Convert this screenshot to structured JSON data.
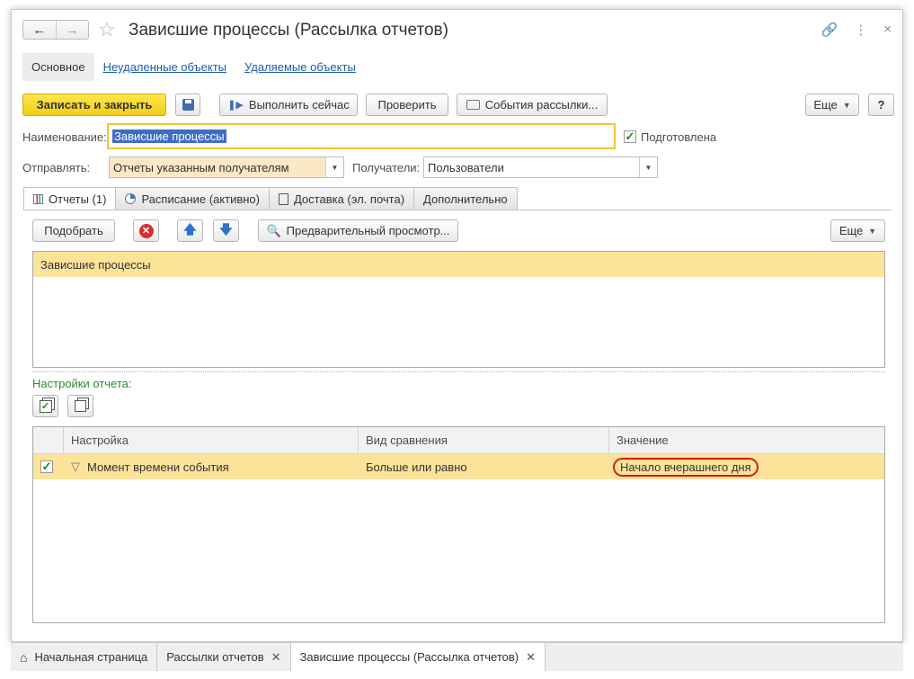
{
  "window": {
    "title": "Зависшие процессы (Рассылка отчетов)"
  },
  "form_tabs": [
    {
      "label": "Основное"
    },
    {
      "label": "Неудаленные объекты"
    },
    {
      "label": "Удаляемые объекты"
    }
  ],
  "toolbar": {
    "save_close": "Записать и закрыть",
    "run_now": "Выполнить сейчас",
    "check": "Проверить",
    "events": "События рассылки...",
    "more": "Еще",
    "help": "?"
  },
  "fields": {
    "name_label": "Наименование:",
    "name_value": "Зависшие процессы",
    "prepared_label": "Подготовлена",
    "send_label": "Отправлять:",
    "send_value": "Отчеты указанным получателям",
    "recipients_label": "Получатели:",
    "recipients_value": "Пользователи"
  },
  "tabs": [
    {
      "label": "Отчеты (1)"
    },
    {
      "label": "Расписание (активно)"
    },
    {
      "label": "Доставка (эл. почта)"
    },
    {
      "label": "Дополнительно"
    }
  ],
  "reports_toolbar": {
    "pick": "Подобрать",
    "preview": "Предварительный просмотр...",
    "more": "Еще"
  },
  "reports": [
    {
      "name": "Зависшие процессы"
    }
  ],
  "settings": {
    "title": "Настройки отчета:",
    "columns": [
      "Настройка",
      "Вид сравнения",
      "Значение"
    ],
    "rows": [
      {
        "setting": "Момент времени события",
        "comparison": "Больше или равно",
        "value": "Начало вчерашнего дня"
      }
    ]
  },
  "taskbar": {
    "home": "Начальная страница",
    "tab1": "Рассылки отчетов",
    "tab2": "Зависшие процессы (Рассылка отчетов)"
  }
}
